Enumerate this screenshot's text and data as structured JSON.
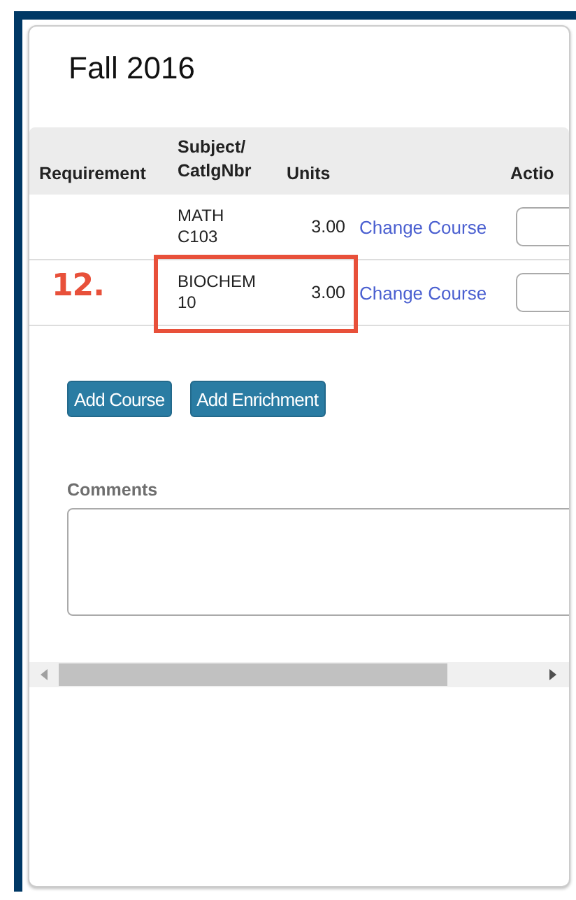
{
  "term": {
    "title": "Fall 2016"
  },
  "table": {
    "columns": [
      "Requirement",
      "Subject/ CatlgNbr",
      "Units",
      "Actio"
    ],
    "rows": [
      {
        "requirement": "",
        "course": "MATH C103",
        "units": "3.00",
        "link": "Change Course",
        "highlighted": false
      },
      {
        "requirement": "",
        "course": "BIOCHEM 10",
        "units": "3.00",
        "link": "Change Course",
        "highlighted": true,
        "step_label": "12."
      }
    ]
  },
  "buttons": [
    "Add Course",
    "Add Enrichment"
  ],
  "comments": {
    "label": "Comments"
  }
}
